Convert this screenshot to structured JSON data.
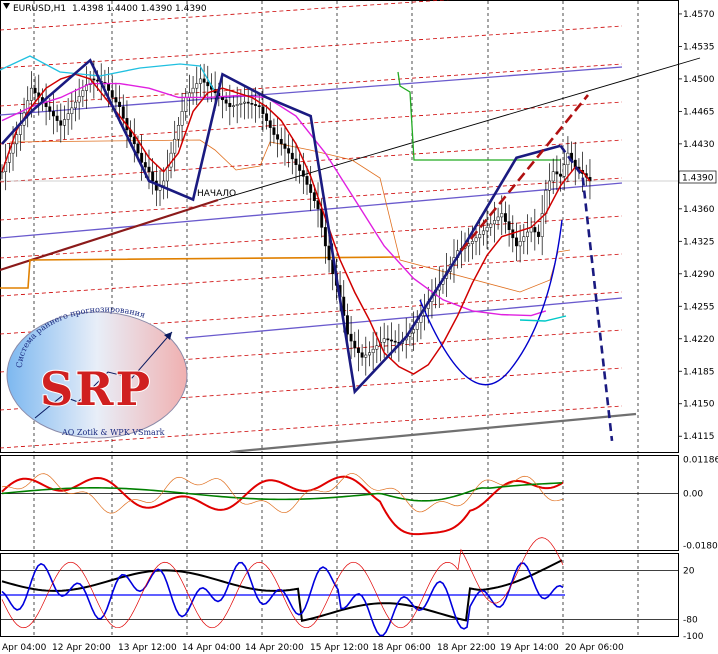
{
  "chart_data": {
    "type": "line",
    "symbol": "EURUSD,H1",
    "ohlc_header": "1.4398 1.4400 1.4390 1.4390",
    "current_price": "1.4390",
    "price_axis_ticks": [
      "1.4570",
      "1.4535",
      "1.4500",
      "1.4465",
      "1.4430",
      "1.4395",
      "1.4360",
      "1.4325",
      "1.4290",
      "1.4255",
      "1.4220",
      "1.4185",
      "1.4150",
      "1.4115"
    ],
    "price_range": [
      1.4098,
      1.4585
    ],
    "x_axis_ticks": [
      "Apr 04:00",
      "12 Apr 20:00",
      "13 Apr 12:00",
      "14 Apr 04:00",
      "14 Apr 20:00",
      "15 Apr 12:00",
      "18 Apr 06:00",
      "18 Apr 22:00",
      "19 Apr 14:00",
      "20 Apr 06:00"
    ],
    "osc1": {
      "ticks": [
        "0.01186",
        "0.00",
        "-0.01802"
      ],
      "range": [
        -0.0195,
        0.013
      ]
    },
    "osc2": {
      "ticks": [
        "20",
        "-80",
        "-100"
      ],
      "range": [
        -100,
        0
      ]
    },
    "wave_annotation": "НАЧАЛО",
    "series": [
      {
        "name": "",
        "x": [
          0,
          4,
          8,
          12,
          16,
          20,
          24,
          28,
          32,
          36,
          40,
          44,
          48,
          52,
          56,
          60,
          64,
          68,
          72,
          76,
          80,
          84,
          88,
          92,
          96,
          100,
          104,
          108,
          112,
          116,
          120,
          124,
          128,
          132,
          136,
          140,
          144,
          148,
          152,
          156,
          158,
          160
        ],
        "y": [
          1.44,
          1.4445,
          1.447,
          1.449,
          1.45,
          1.4505,
          1.45,
          1.448,
          1.446,
          1.444,
          1.4415,
          1.44,
          1.442,
          1.4465,
          1.4485,
          1.449,
          1.4485,
          1.448,
          1.447,
          1.4455,
          1.443,
          1.4395,
          1.435,
          1.4305,
          1.427,
          1.424,
          1.4205,
          1.419,
          1.4182,
          1.4192,
          1.4215,
          1.4245,
          1.428,
          1.431,
          1.433,
          1.4335,
          1.434,
          1.4355,
          1.4385,
          1.4405,
          1.44,
          1.439
        ]
      },
      {
        "name": "",
        "x": [
          0,
          8,
          16,
          24,
          32,
          40,
          48,
          56,
          64,
          72,
          80,
          88,
          96,
          104,
          112,
          120,
          128,
          136,
          144,
          148
        ],
        "y": [
          1.4455,
          1.447,
          1.448,
          1.4495,
          1.4495,
          1.449,
          1.448,
          1.448,
          1.4482,
          1.448,
          1.446,
          1.442,
          1.437,
          1.432,
          1.4285,
          1.4262,
          1.425,
          1.4246,
          1.4245,
          1.425
        ]
      },
      {
        "name": "",
        "x": [
          0,
          5,
          8,
          12,
          16,
          20,
          24,
          28,
          30,
          32,
          34,
          36,
          38,
          40,
          42,
          44,
          46,
          48,
          50,
          54,
          58,
          62,
          66,
          70,
          74,
          78,
          82,
          86,
          88,
          90,
          92,
          94,
          96,
          98,
          100,
          104,
          108,
          112,
          116,
          120,
          124,
          128,
          132,
          136,
          140,
          144,
          146,
          148,
          150,
          152,
          154,
          156,
          158,
          160
        ],
        "y": [
          1.44,
          1.445,
          1.449,
          1.447,
          1.445,
          1.4475,
          1.45,
          1.4495,
          1.448,
          1.447,
          1.4445,
          1.443,
          1.441,
          1.44,
          1.438,
          1.439,
          1.442,
          1.445,
          1.448,
          1.45,
          1.4485,
          1.447,
          1.4475,
          1.447,
          1.444,
          1.442,
          1.4395,
          1.436,
          1.432,
          1.429,
          1.4265,
          1.4225,
          1.421,
          1.42,
          1.4205,
          1.422,
          1.4215,
          1.423,
          1.426,
          1.4285,
          1.4315,
          1.4325,
          1.434,
          1.4355,
          1.432,
          1.434,
          1.433,
          1.438,
          1.44,
          1.4395,
          1.442,
          1.4405,
          1.4398,
          1.439
        ]
      },
      {
        "name": "",
        "x": [
          0,
          8,
          24,
          40,
          52,
          60,
          72,
          84,
          96,
          110,
          125,
          140,
          152,
          158,
          166
        ],
        "y": [
          1.443,
          1.4465,
          1.452,
          1.439,
          1.437,
          1.4505,
          1.448,
          1.446,
          1.4163,
          1.4222,
          1.4315,
          1.4415,
          1.4428,
          1.4395,
          1.411
        ]
      }
    ]
  },
  "logo": {
    "letters": "SRP",
    "arc_text": "Система раннего прогнозирования",
    "bottom_text": "AO Zotik & WPK VSmark"
  }
}
